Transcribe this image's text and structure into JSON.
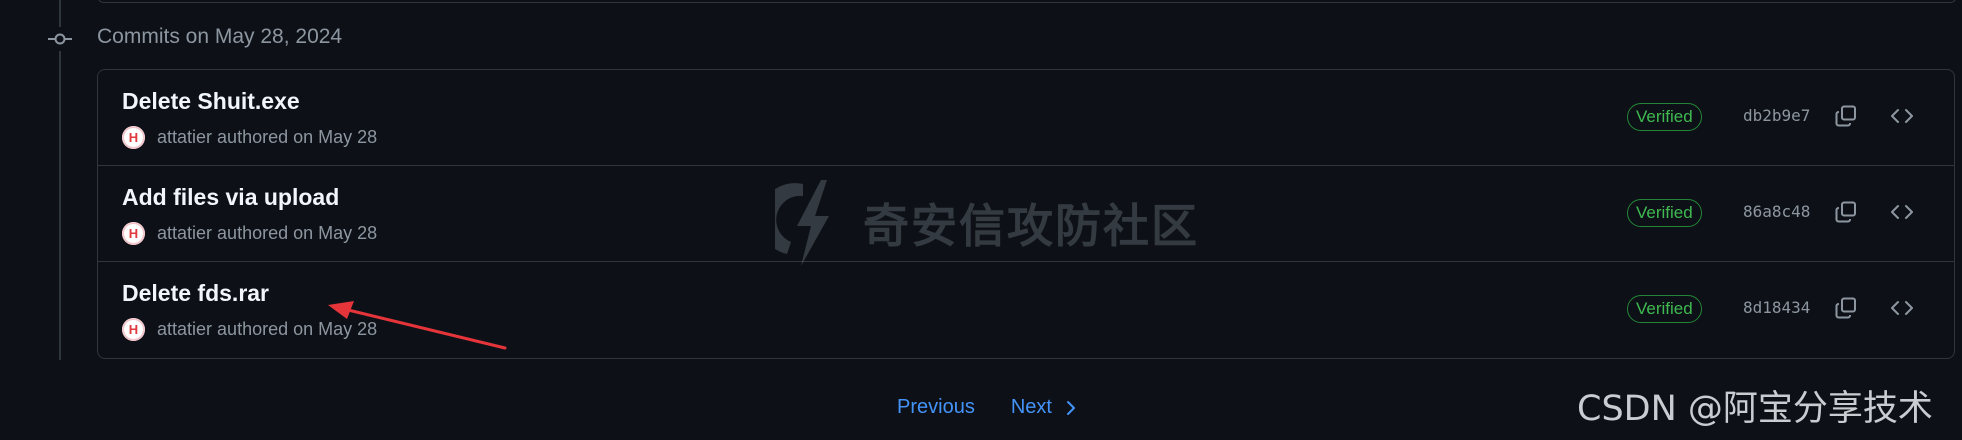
{
  "group": {
    "header": "Commits on May 28, 2024"
  },
  "commits": [
    {
      "title": "Delete Shuit.exe",
      "author": "attatier",
      "authored_text": "authored on May 28",
      "badge": "Verified",
      "sha": "db2b9e7",
      "avatar_letter": "H"
    },
    {
      "title": "Add files via upload",
      "author": "attatier",
      "authored_text": "authored on May 28",
      "badge": "Verified",
      "sha": "86a8c48",
      "avatar_letter": "H"
    },
    {
      "title": "Delete fds.rar",
      "author": "attatier",
      "authored_text": "authored on May 28",
      "badge": "Verified",
      "sha": "8d18434",
      "avatar_letter": "H"
    }
  ],
  "pagination": {
    "previous": "Previous",
    "next": "Next"
  },
  "watermarks": {
    "center": "奇安信攻防社区",
    "corner": "CSDN @阿宝分享技术"
  },
  "icons": {
    "commit": "git-commit-icon",
    "copy": "copy-icon",
    "browse": "code-icon",
    "next": "chevron-right-icon"
  },
  "colors": {
    "background": "#0d1117",
    "border": "#30363d",
    "link": "#4493f8",
    "verified": "#3fb950",
    "annotation": "#e5343a"
  }
}
